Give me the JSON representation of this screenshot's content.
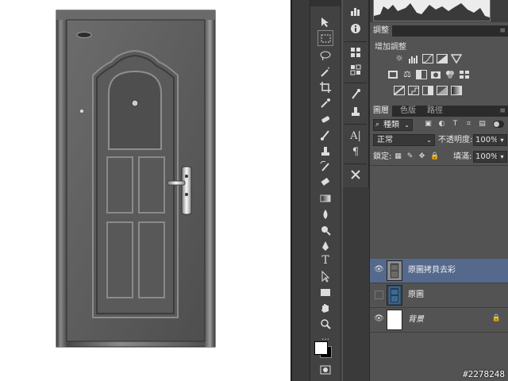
{
  "canvas": {
    "image_subject": "steel security door"
  },
  "toolbar": {
    "tools": [
      "move-tool",
      "marquee-tool",
      "lasso-tool",
      "magic-wand-tool",
      "crop-tool",
      "eyedropper-tool",
      "healing-brush-tool",
      "brush-tool",
      "clone-stamp-tool",
      "history-brush-tool",
      "eraser-tool",
      "gradient-tool",
      "blur-tool",
      "dodge-tool",
      "pen-tool",
      "type-tool",
      "path-selection-tool",
      "shape-tool",
      "hand-tool",
      "zoom-tool",
      "more-tools",
      "foreground-color",
      "quick-mask-tool"
    ],
    "type_tool_glyph": "T"
  },
  "dock": {
    "type_glyph": "A|",
    "paragraph_glyph": "¶"
  },
  "adjustments_panel": {
    "tab_label": "調整",
    "add_label": "增加調整"
  },
  "layers_panel": {
    "tabs": [
      "圖層",
      "色版",
      "路徑"
    ],
    "filter_kind": "種類",
    "blend_mode": "正常",
    "opacity_label": "不透明度:",
    "opacity_value": "100%",
    "lock_label": "鎖定:",
    "fill_label": "填滿:",
    "fill_value": "100%",
    "layers": [
      {
        "name": "原圖拷貝去彩",
        "visible": true,
        "selected": true
      },
      {
        "name": "原圖",
        "visible": false,
        "selected": false
      },
      {
        "name": "背景",
        "visible": true,
        "selected": false,
        "locked": true
      }
    ]
  },
  "colors": {
    "panel_bg": "#535353",
    "toolbar_bg": "#424242",
    "selected_layer": "#55698d"
  },
  "watermark": "#2278248"
}
